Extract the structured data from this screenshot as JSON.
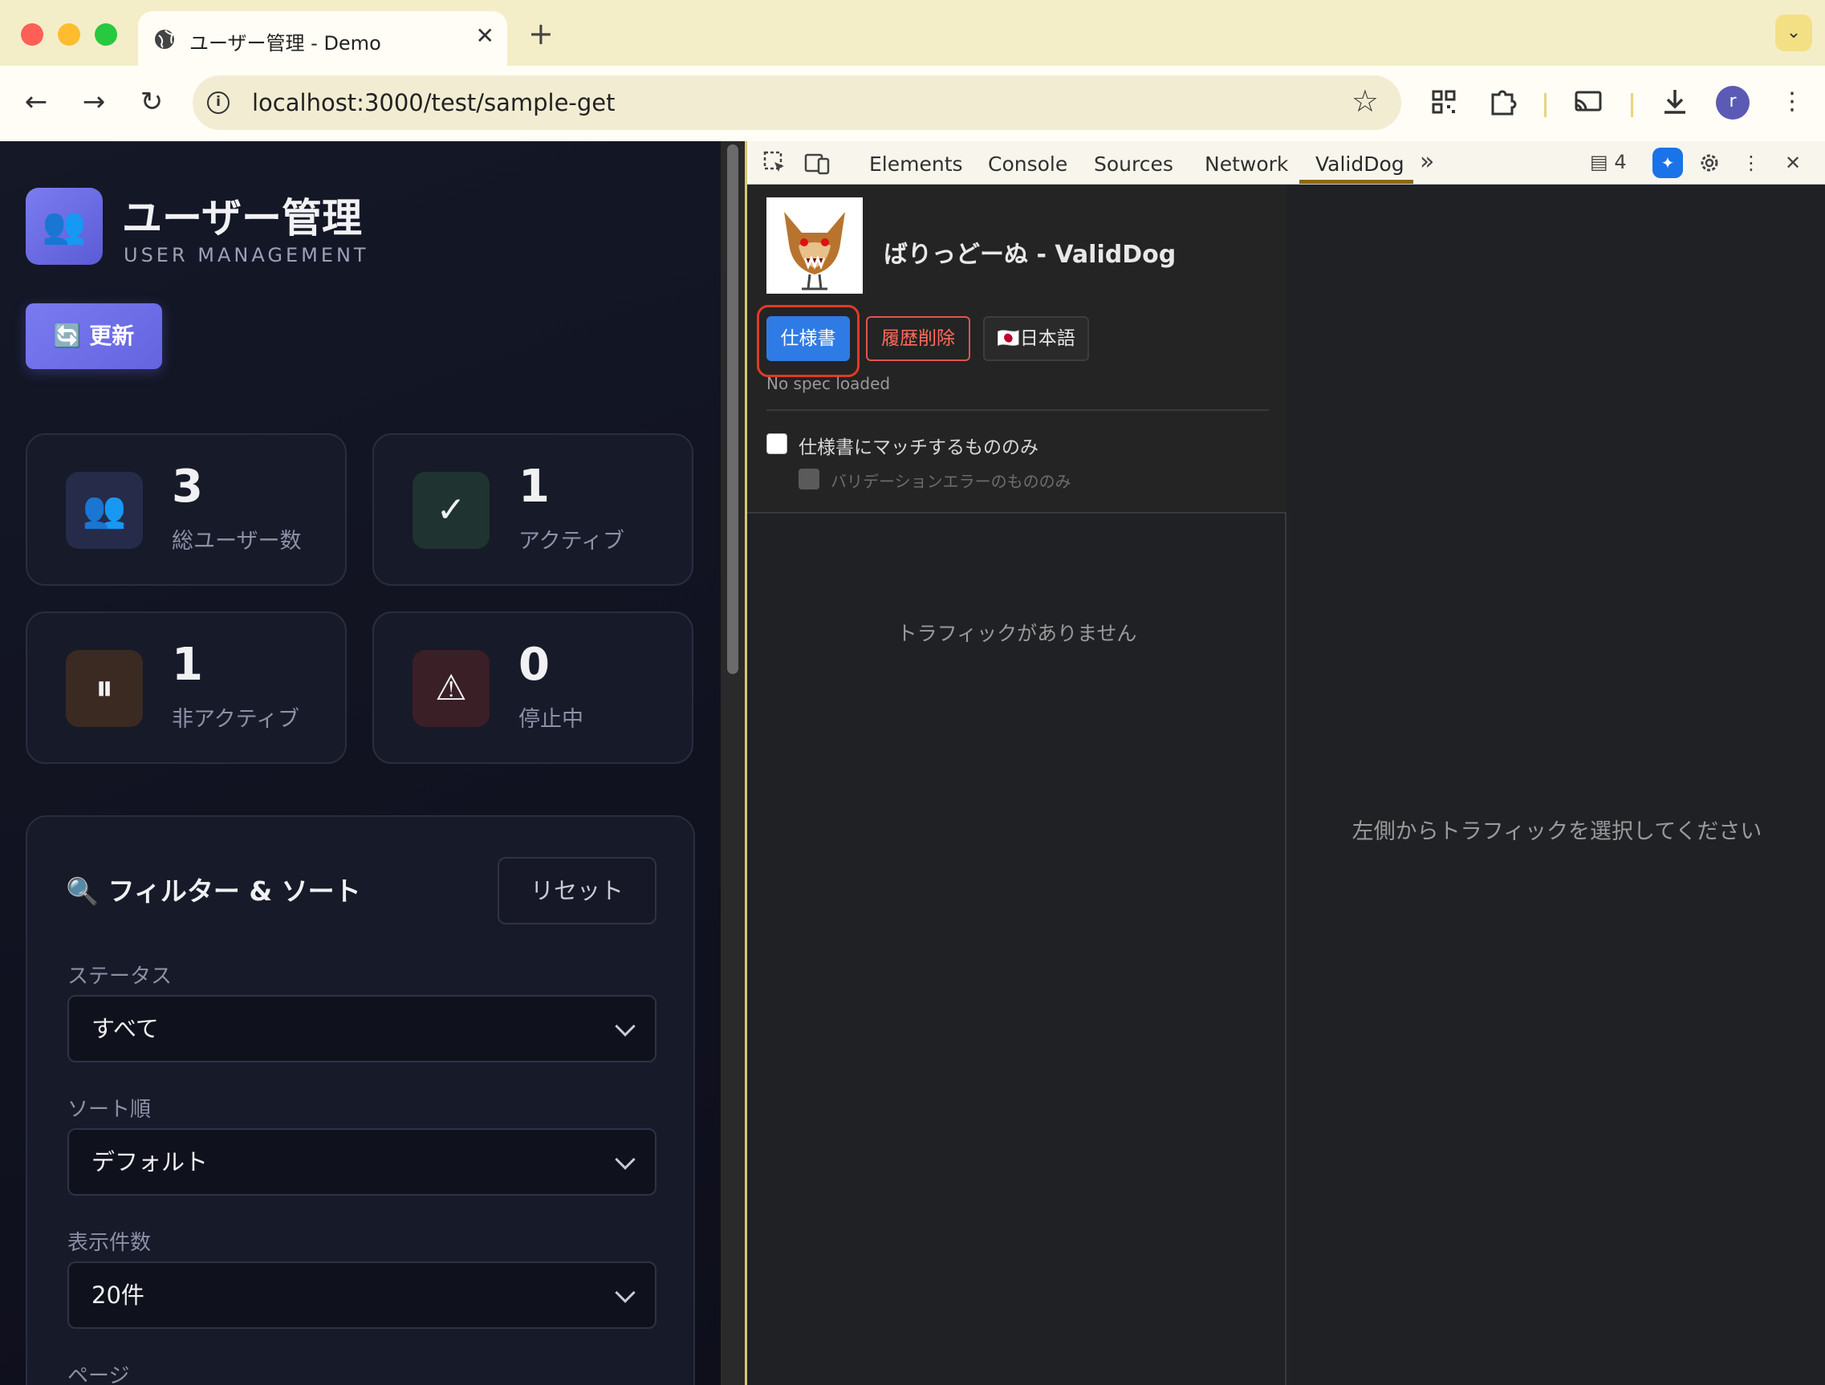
{
  "browser": {
    "tab_title": "ユーザー管理 - Demo",
    "tab_close": "✕",
    "new_tab": "+",
    "url": "localhost:3000/test/sample-get",
    "avatar_initial": "r",
    "tab_search": "⌄"
  },
  "app": {
    "title": "ユーザー管理",
    "subtitle": "USER MANAGEMENT",
    "logo_glyph": "👥",
    "refresh_label": "🔄 更新",
    "stats": [
      {
        "value": "3",
        "label": "総ユーザー数",
        "icon": "👥",
        "icon_bg": "#262b4a"
      },
      {
        "value": "1",
        "label": "アクティブ",
        "icon": "✓",
        "icon_bg": "#1f3330"
      },
      {
        "value": "1",
        "label": "非アクティブ",
        "icon": "⏸",
        "icon_bg": "#3a2a22"
      },
      {
        "value": "0",
        "label": "停止中",
        "icon": "⚠",
        "icon_bg": "#3a1f26"
      }
    ],
    "filter": {
      "title": "🔍 フィルター & ソート",
      "reset_label": "リセット",
      "status_label": "ステータス",
      "status_value": "すべて",
      "sort_label": "ソート順",
      "sort_value": "デフォルト",
      "per_page_label": "表示件数",
      "per_page_value": "20件",
      "page_label": "ページ"
    }
  },
  "devtools": {
    "tabs": [
      "Elements",
      "Console",
      "Sources",
      "Network",
      "ValidDog"
    ],
    "active_tab": "ValidDog",
    "issues_count": "4",
    "validdog": {
      "title": "ばりっどーぬ - ValidDog",
      "spec_button": "仕様書",
      "clear_button": "履歴削除",
      "lang_button": "🇯🇵日本語",
      "spec_status": "No spec loaded",
      "match_only_label": "仕様書にマッチするもののみ",
      "validation_error_label": "バリデーションエラーのもののみ",
      "no_traffic": "トラフィックがありません",
      "select_hint": "左側からトラフィックを選択してください"
    }
  },
  "colors": {
    "accent": "#6c6ce6",
    "spec_button": "#2f7be5",
    "highlight_ring": "#e03a24",
    "danger": "#ff6b5e"
  }
}
